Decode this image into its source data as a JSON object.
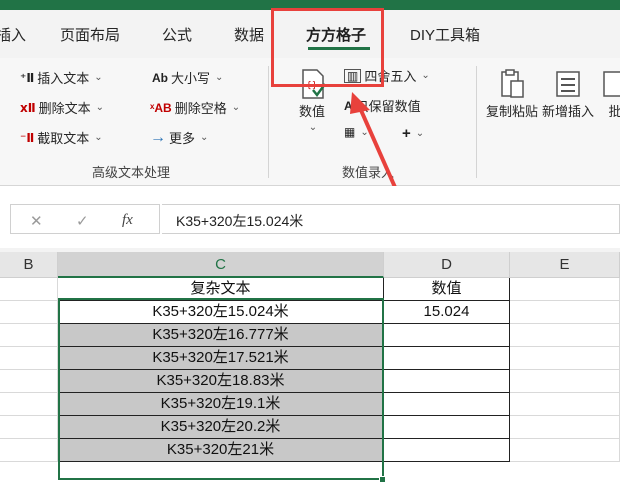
{
  "tabs": [
    {
      "label": "插入",
      "display": "插入"
    },
    {
      "label": "页面布局"
    },
    {
      "label": "公式"
    },
    {
      "label": "数据"
    },
    {
      "label": "方方格子"
    },
    {
      "label": "DIY工具箱"
    }
  ],
  "ribbon": {
    "text_group": {
      "insert_text": "插入文本",
      "delete_text": "删除文本",
      "extract_text": "截取文本",
      "case": "大小写",
      "delete_spaces": "删除空格",
      "more": "更多",
      "group_label": "高级文本处理"
    },
    "number_group": {
      "value_btn": "数值",
      "round": "四舍五入",
      "keep_values": "只保留数值",
      "group_label": "数值录入"
    },
    "paste_group": {
      "copy_paste": "复制粘贴",
      "add_insert": "新增插入",
      "batch": "批"
    }
  },
  "formula_bar": {
    "cancel": "✕",
    "confirm": "✓",
    "fx": "fx",
    "content": "K35+320左15.024米"
  },
  "columns": [
    "B",
    "C",
    "D",
    "E"
  ],
  "table": {
    "header_c": "复杂文本",
    "header_d": "数值",
    "rows": [
      {
        "c": "K35+320左15.024米",
        "d": "15.024"
      },
      {
        "c": "K35+320左16.777米",
        "d": ""
      },
      {
        "c": "K35+320左17.521米",
        "d": ""
      },
      {
        "c": "K35+320左18.83米",
        "d": ""
      },
      {
        "c": "K35+320左19.1米",
        "d": ""
      },
      {
        "c": "K35+320左20.2米",
        "d": ""
      },
      {
        "c": "K35+320左21米",
        "d": ""
      }
    ]
  },
  "colors": {
    "accent": "#217346",
    "highlight": "#e8413c"
  }
}
